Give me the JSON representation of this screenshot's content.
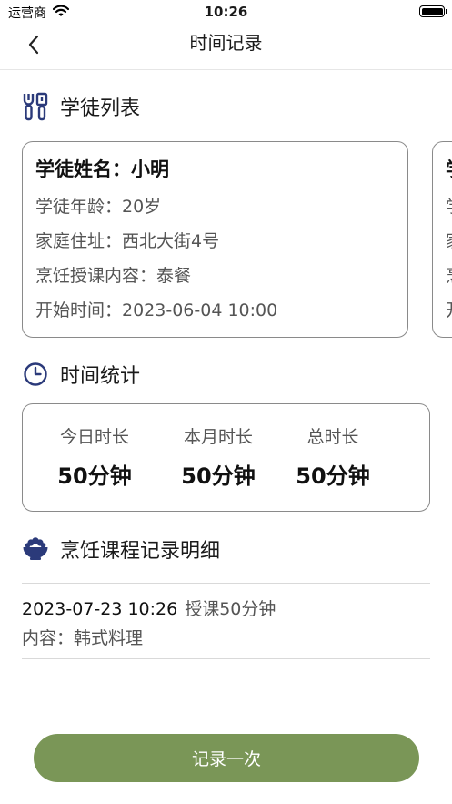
{
  "status_bar": {
    "carrier": "运营商",
    "time": "10:26",
    "battery_level": 1.0
  },
  "nav": {
    "title": "时间记录"
  },
  "students_section": {
    "title": "学徒列表",
    "icon": "kitchen-utensils-icon",
    "students": [
      {
        "name_line": "学徒姓名：小明",
        "age_line": "学徒年龄：20岁",
        "address_line": "家庭住址：西北大街4号",
        "course_line": "烹饪授课内容：泰餐",
        "start_line": "开始时间：2023-06-04 10:00"
      },
      {
        "name_line": "学",
        "age_line": "学",
        "address_line": "家",
        "course_line": "烹",
        "start_line": "开"
      }
    ]
  },
  "stats_section": {
    "title": "时间统计",
    "icon": "clock-icon",
    "items": [
      {
        "label": "今日时长",
        "value": "50分钟"
      },
      {
        "label": "本月时长",
        "value": "50分钟"
      },
      {
        "label": "总时长",
        "value": "50分钟"
      }
    ]
  },
  "records_section": {
    "title": "烹饪课程记录明细",
    "icon": "rice-bowl-icon",
    "records": [
      {
        "time": "2023-07-23 10:26",
        "duration": "授课50分钟",
        "content": "内容：韩式料理"
      }
    ]
  },
  "record_button": {
    "label": "记录一次"
  },
  "colors": {
    "accent_green": "#7a9657",
    "icon_navy": "#2b3a7a",
    "text_secondary": "#555555"
  }
}
